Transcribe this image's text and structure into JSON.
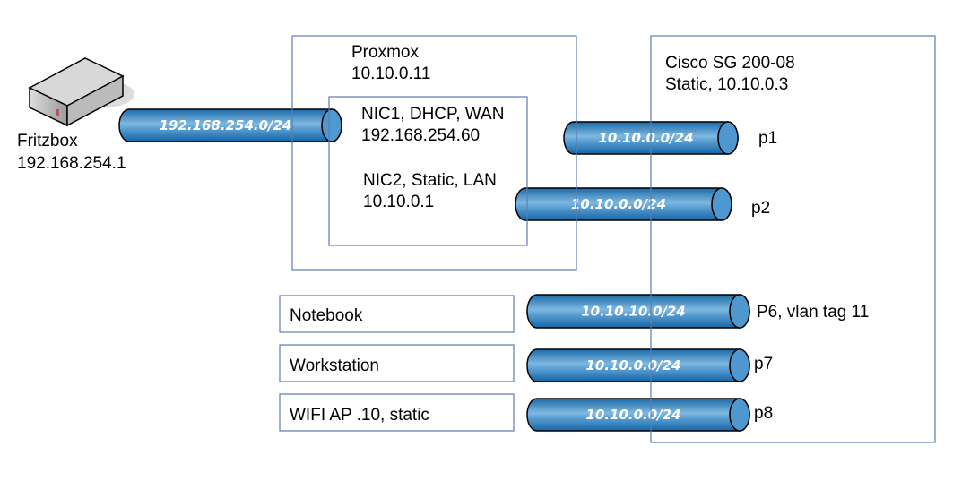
{
  "fritzbox": {
    "name": "Fritzbox",
    "ip": "192.168.254.1",
    "icon": "router-icon"
  },
  "proxmox": {
    "name": "Proxmox",
    "ip": "10.10.0.11",
    "nic1": {
      "line1": "NIC1, DHCP, WAN",
      "line2": "192.168.254.60"
    },
    "nic2": {
      "line1": "NIC2, Static, LAN",
      "line2": "10.10.0.1"
    }
  },
  "cisco": {
    "name": "Cisco SG 200-08",
    "config": "Static, 10.10.0.3"
  },
  "devices": [
    {
      "label": "Notebook"
    },
    {
      "label": "Workstation"
    },
    {
      "label": "WIFI AP .10, static"
    }
  ],
  "links": [
    {
      "subnet": "192.168.254.0/24",
      "port": ""
    },
    {
      "subnet": "10.10.0.0/24",
      "port": "p1"
    },
    {
      "subnet": "10.10.0.0/24",
      "port": "p2"
    },
    {
      "subnet": "10.10.10.0/24",
      "port": "P6, vlan tag 11"
    },
    {
      "subnet": "10.10.0.0/24",
      "port": "p7"
    },
    {
      "subnet": "10.10.0.0/24",
      "port": "p8"
    }
  ],
  "colors": {
    "pipe": "#2a7fc0",
    "box_stroke": "#5b7db5"
  }
}
